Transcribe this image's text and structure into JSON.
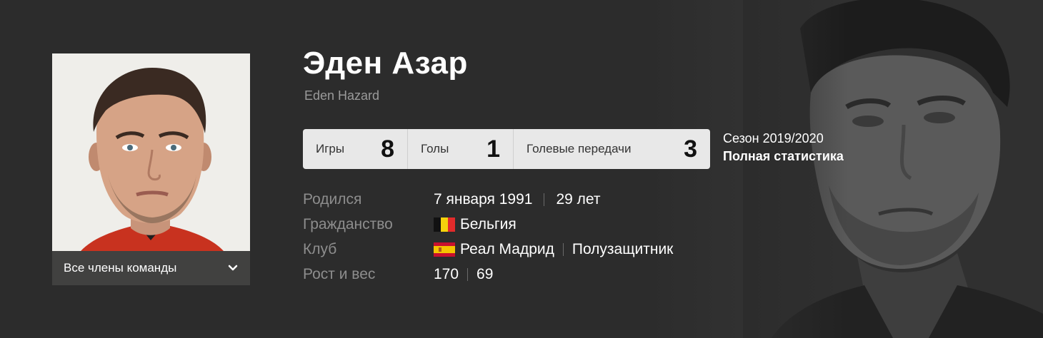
{
  "player": {
    "name": "Эден Азар",
    "name_latin": "Eden Hazard"
  },
  "team_dropdown": {
    "label": "Все члены команды",
    "icon": "chevron-down-icon"
  },
  "stats": {
    "games_label": "Игры",
    "games_value": "8",
    "goals_label": "Голы",
    "goals_value": "1",
    "assists_label": "Голевые передачи",
    "assists_value": "3"
  },
  "season": {
    "label": "Сезон 2019/2020",
    "full_stats_link": "Полная статистика"
  },
  "info": {
    "born_label": "Родился",
    "born_date": "7 января 1991",
    "age": "29 лет",
    "citizenship_label": "Гражданство",
    "citizenship": "Бельгия",
    "citizenship_flag": "belgium-flag-icon",
    "club_label": "Клуб",
    "club": "Реал Мадрид",
    "club_flag": "spain-flag-icon",
    "position": "Полузащитник",
    "height_weight_label": "Рост и вес",
    "height": "170",
    "weight": "69"
  },
  "colors": {
    "background": "#2b2b2b",
    "stats_bar": "#e8e8e8",
    "label_gray": "#8d8d8d"
  }
}
